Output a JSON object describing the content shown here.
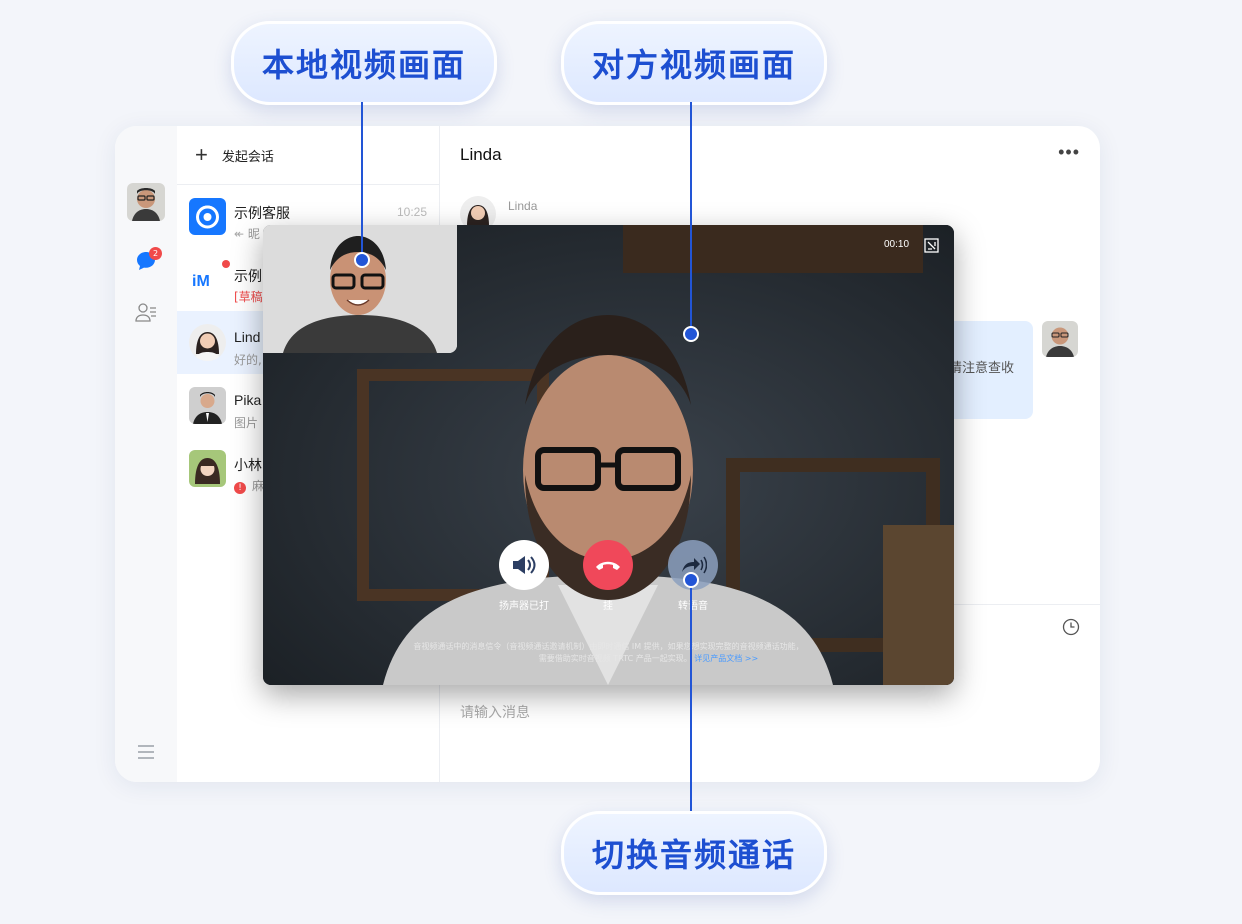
{
  "callouts": {
    "local_video": "本地视频画面",
    "remote_video": "对方视频画面",
    "switch_audio": "切换音频通话"
  },
  "rail": {
    "unread_badge": "2"
  },
  "conversation_list": {
    "new_chat_label": "发起会话",
    "items": [
      {
        "name": "示例客服",
        "sub": "昵",
        "time": "10:25"
      },
      {
        "name": "示例",
        "sub": "[草稿",
        "time": ""
      },
      {
        "name": "Lind",
        "sub": "好的,",
        "time": ""
      },
      {
        "name": "Pika",
        "sub": "图片",
        "time": ""
      },
      {
        "name": "小林",
        "sub": "麻",
        "time": ""
      }
    ]
  },
  "chat": {
    "title": "Linda",
    "sender_name": "Linda",
    "partial_message": "请注意查收",
    "input_placeholder": "请输入消息"
  },
  "video_call": {
    "duration": "00:10",
    "speaker_label": "扬声器已打",
    "hangup_label": "挂",
    "switch_label": "转语音",
    "notice_line1": "音视频通话中的消息信令（音视频通话邀请机制）由即时通信 IM 提供，如果您想实现完整的音视频通话功能，",
    "notice_line2": "需要借助实时音视频 TRTC 产品一起实现。",
    "notice_link": "详见产品文档 >>"
  },
  "colors": {
    "accent": "#1d4fd1",
    "brand_blue": "#1677ff",
    "hangup_red": "#f0485a",
    "badge_red": "#f04a4a"
  }
}
